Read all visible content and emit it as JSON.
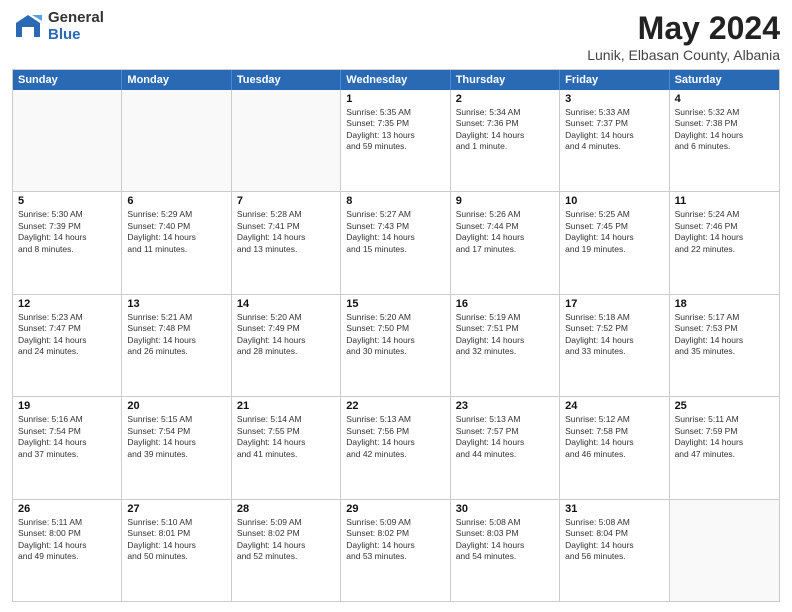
{
  "logo": {
    "general": "General",
    "blue": "Blue"
  },
  "title": {
    "month": "May 2024",
    "location": "Lunik, Elbasan County, Albania"
  },
  "header_days": [
    "Sunday",
    "Monday",
    "Tuesday",
    "Wednesday",
    "Thursday",
    "Friday",
    "Saturday"
  ],
  "weeks": [
    [
      {
        "day": "",
        "text": ""
      },
      {
        "day": "",
        "text": ""
      },
      {
        "day": "",
        "text": ""
      },
      {
        "day": "1",
        "text": "Sunrise: 5:35 AM\nSunset: 7:35 PM\nDaylight: 13 hours\nand 59 minutes."
      },
      {
        "day": "2",
        "text": "Sunrise: 5:34 AM\nSunset: 7:36 PM\nDaylight: 14 hours\nand 1 minute."
      },
      {
        "day": "3",
        "text": "Sunrise: 5:33 AM\nSunset: 7:37 PM\nDaylight: 14 hours\nand 4 minutes."
      },
      {
        "day": "4",
        "text": "Sunrise: 5:32 AM\nSunset: 7:38 PM\nDaylight: 14 hours\nand 6 minutes."
      }
    ],
    [
      {
        "day": "5",
        "text": "Sunrise: 5:30 AM\nSunset: 7:39 PM\nDaylight: 14 hours\nand 8 minutes."
      },
      {
        "day": "6",
        "text": "Sunrise: 5:29 AM\nSunset: 7:40 PM\nDaylight: 14 hours\nand 11 minutes."
      },
      {
        "day": "7",
        "text": "Sunrise: 5:28 AM\nSunset: 7:41 PM\nDaylight: 14 hours\nand 13 minutes."
      },
      {
        "day": "8",
        "text": "Sunrise: 5:27 AM\nSunset: 7:43 PM\nDaylight: 14 hours\nand 15 minutes."
      },
      {
        "day": "9",
        "text": "Sunrise: 5:26 AM\nSunset: 7:44 PM\nDaylight: 14 hours\nand 17 minutes."
      },
      {
        "day": "10",
        "text": "Sunrise: 5:25 AM\nSunset: 7:45 PM\nDaylight: 14 hours\nand 19 minutes."
      },
      {
        "day": "11",
        "text": "Sunrise: 5:24 AM\nSunset: 7:46 PM\nDaylight: 14 hours\nand 22 minutes."
      }
    ],
    [
      {
        "day": "12",
        "text": "Sunrise: 5:23 AM\nSunset: 7:47 PM\nDaylight: 14 hours\nand 24 minutes."
      },
      {
        "day": "13",
        "text": "Sunrise: 5:21 AM\nSunset: 7:48 PM\nDaylight: 14 hours\nand 26 minutes."
      },
      {
        "day": "14",
        "text": "Sunrise: 5:20 AM\nSunset: 7:49 PM\nDaylight: 14 hours\nand 28 minutes."
      },
      {
        "day": "15",
        "text": "Sunrise: 5:20 AM\nSunset: 7:50 PM\nDaylight: 14 hours\nand 30 minutes."
      },
      {
        "day": "16",
        "text": "Sunrise: 5:19 AM\nSunset: 7:51 PM\nDaylight: 14 hours\nand 32 minutes."
      },
      {
        "day": "17",
        "text": "Sunrise: 5:18 AM\nSunset: 7:52 PM\nDaylight: 14 hours\nand 33 minutes."
      },
      {
        "day": "18",
        "text": "Sunrise: 5:17 AM\nSunset: 7:53 PM\nDaylight: 14 hours\nand 35 minutes."
      }
    ],
    [
      {
        "day": "19",
        "text": "Sunrise: 5:16 AM\nSunset: 7:54 PM\nDaylight: 14 hours\nand 37 minutes."
      },
      {
        "day": "20",
        "text": "Sunrise: 5:15 AM\nSunset: 7:54 PM\nDaylight: 14 hours\nand 39 minutes."
      },
      {
        "day": "21",
        "text": "Sunrise: 5:14 AM\nSunset: 7:55 PM\nDaylight: 14 hours\nand 41 minutes."
      },
      {
        "day": "22",
        "text": "Sunrise: 5:13 AM\nSunset: 7:56 PM\nDaylight: 14 hours\nand 42 minutes."
      },
      {
        "day": "23",
        "text": "Sunrise: 5:13 AM\nSunset: 7:57 PM\nDaylight: 14 hours\nand 44 minutes."
      },
      {
        "day": "24",
        "text": "Sunrise: 5:12 AM\nSunset: 7:58 PM\nDaylight: 14 hours\nand 46 minutes."
      },
      {
        "day": "25",
        "text": "Sunrise: 5:11 AM\nSunset: 7:59 PM\nDaylight: 14 hours\nand 47 minutes."
      }
    ],
    [
      {
        "day": "26",
        "text": "Sunrise: 5:11 AM\nSunset: 8:00 PM\nDaylight: 14 hours\nand 49 minutes."
      },
      {
        "day": "27",
        "text": "Sunrise: 5:10 AM\nSunset: 8:01 PM\nDaylight: 14 hours\nand 50 minutes."
      },
      {
        "day": "28",
        "text": "Sunrise: 5:09 AM\nSunset: 8:02 PM\nDaylight: 14 hours\nand 52 minutes."
      },
      {
        "day": "29",
        "text": "Sunrise: 5:09 AM\nSunset: 8:02 PM\nDaylight: 14 hours\nand 53 minutes."
      },
      {
        "day": "30",
        "text": "Sunrise: 5:08 AM\nSunset: 8:03 PM\nDaylight: 14 hours\nand 54 minutes."
      },
      {
        "day": "31",
        "text": "Sunrise: 5:08 AM\nSunset: 8:04 PM\nDaylight: 14 hours\nand 56 minutes."
      },
      {
        "day": "",
        "text": ""
      }
    ]
  ]
}
